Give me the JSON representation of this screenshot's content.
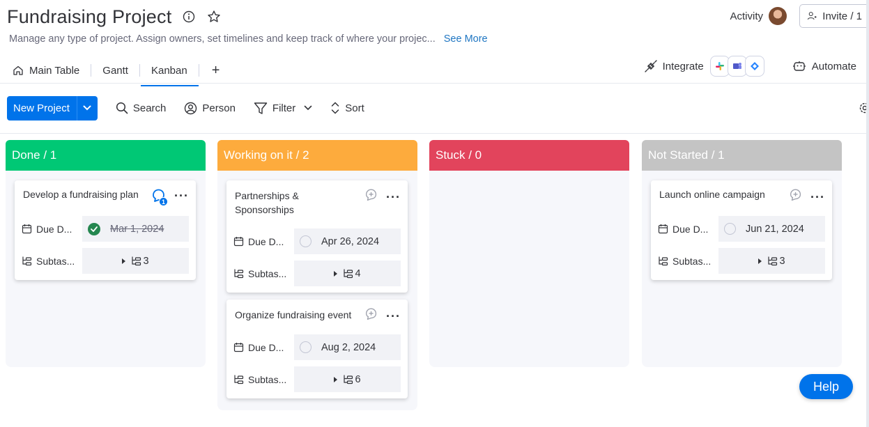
{
  "header": {
    "title": "Fundraising Project",
    "description": "Manage any type of project. Assign owners, set timelines and keep track of where your projec...",
    "see_more": "See More",
    "activity": "Activity",
    "invite": "Invite / 1"
  },
  "tabs": [
    {
      "label": "Main Table",
      "icon": "home-icon"
    },
    {
      "label": "Gantt"
    },
    {
      "label": "Kanban",
      "active": true
    }
  ],
  "tab_actions": {
    "integrate": "Integrate",
    "automate": "Automate"
  },
  "toolbar": {
    "new_project": "New Project",
    "search": "Search",
    "person": "Person",
    "filter": "Filter",
    "sort": "Sort"
  },
  "columns": [
    {
      "label": "Done / 1",
      "color": "#00c875",
      "cards": [
        {
          "title": "Develop a fundraising plan",
          "due_label": "Due D...",
          "due": "Mar 1, 2024",
          "done": true,
          "sub_label": "Subtas...",
          "subtasks": "3",
          "updates": "1"
        }
      ]
    },
    {
      "label": "Working on it / 2",
      "color": "#fdab3d",
      "cards": [
        {
          "title": "Partnerships & Sponsorships",
          "due_label": "Due D...",
          "due": "Apr 26, 2024",
          "sub_label": "Subtas...",
          "subtasks": "4"
        },
        {
          "title": "Organize fundraising event",
          "due_label": "Due D...",
          "due": "Aug 2, 2024",
          "sub_label": "Subtas...",
          "subtasks": "6"
        }
      ]
    },
    {
      "label": "Stuck / 0",
      "color": "#e2445c",
      "cards": []
    },
    {
      "label": "Not Started / 1",
      "color": "#c4c4c4",
      "cards": [
        {
          "title": "Launch online campaign",
          "due_label": "Due D...",
          "due": "Jun 21, 2024",
          "sub_label": "Subtas...",
          "subtasks": "3"
        }
      ]
    }
  ],
  "help": "Help"
}
